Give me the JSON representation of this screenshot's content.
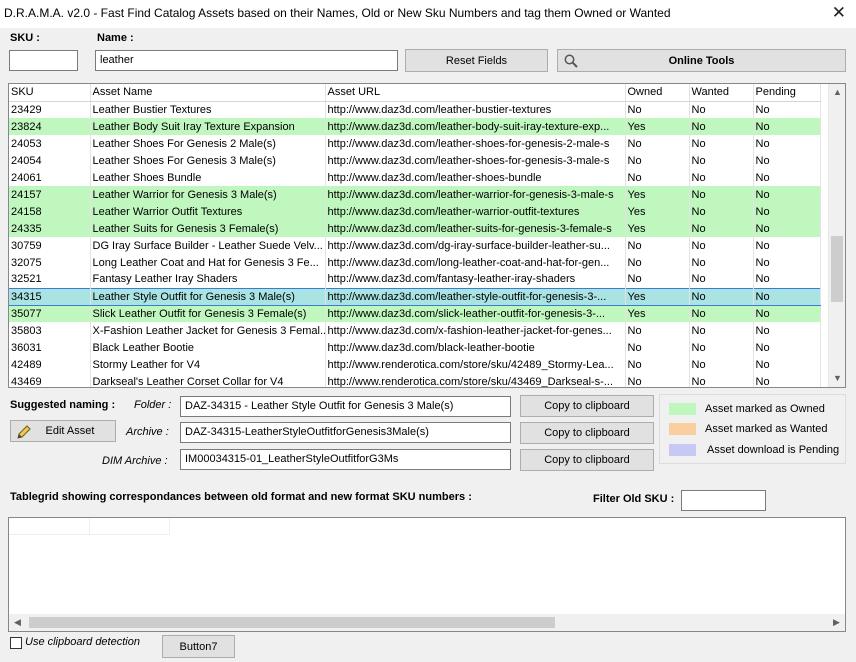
{
  "window": {
    "title": "D.R.A.M.A. v2.0 - Fast Find Catalog Assets based on their Names, Old or New Sku Numbers and tag them Owned or Wanted",
    "close_icon": "close-icon"
  },
  "search": {
    "sku_label": "SKU :",
    "sku_value": "",
    "name_label": "Name :",
    "name_value": "leather",
    "reset_label": "Reset Fields",
    "online_tools_label": "Online Tools",
    "online_tools_icon": "search-icon"
  },
  "assets": {
    "columns": [
      "SKU",
      "Asset Name",
      "Asset URL",
      "Owned",
      "Wanted",
      "Pending"
    ],
    "rows": [
      {
        "sku": "23429",
        "name": "Leather Bustier Textures",
        "url": "http://www.daz3d.com/leather-bustier-textures",
        "owned": "No",
        "wanted": "No",
        "pending": "No",
        "state": "normal"
      },
      {
        "sku": "23824",
        "name": "Leather Body Suit Iray Texture Expansion",
        "url": "http://www.daz3d.com/leather-body-suit-iray-texture-exp...",
        "owned": "Yes",
        "wanted": "No",
        "pending": "No",
        "state": "owned"
      },
      {
        "sku": "24053",
        "name": "Leather Shoes For Genesis 2 Male(s)",
        "url": "http://www.daz3d.com/leather-shoes-for-genesis-2-male-s",
        "owned": "No",
        "wanted": "No",
        "pending": "No",
        "state": "normal"
      },
      {
        "sku": "24054",
        "name": "Leather Shoes For Genesis 3 Male(s)",
        "url": "http://www.daz3d.com/leather-shoes-for-genesis-3-male-s",
        "owned": "No",
        "wanted": "No",
        "pending": "No",
        "state": "normal"
      },
      {
        "sku": "24061",
        "name": "Leather Shoes Bundle",
        "url": "http://www.daz3d.com/leather-shoes-bundle",
        "owned": "No",
        "wanted": "No",
        "pending": "No",
        "state": "normal"
      },
      {
        "sku": "24157",
        "name": "Leather Warrior for Genesis 3 Male(s)",
        "url": "http://www.daz3d.com/leather-warrior-for-genesis-3-male-s",
        "owned": "Yes",
        "wanted": "No",
        "pending": "No",
        "state": "owned"
      },
      {
        "sku": "24158",
        "name": "Leather Warrior Outfit Textures",
        "url": "http://www.daz3d.com/leather-warrior-outfit-textures",
        "owned": "Yes",
        "wanted": "No",
        "pending": "No",
        "state": "owned"
      },
      {
        "sku": "24335",
        "name": "Leather Suits for Genesis 3 Female(s)",
        "url": "http://www.daz3d.com/leather-suits-for-genesis-3-female-s",
        "owned": "Yes",
        "wanted": "No",
        "pending": "No",
        "state": "owned"
      },
      {
        "sku": "30759",
        "name": "DG Iray Surface Builder - Leather Suede Velv...",
        "url": "http://www.daz3d.com/dg-iray-surface-builder-leather-su...",
        "owned": "No",
        "wanted": "No",
        "pending": "No",
        "state": "normal"
      },
      {
        "sku": "32075",
        "name": "Long Leather Coat and Hat for Genesis 3 Fe...",
        "url": "http://www.daz3d.com/long-leather-coat-and-hat-for-gen...",
        "owned": "No",
        "wanted": "No",
        "pending": "No",
        "state": "normal"
      },
      {
        "sku": "32521",
        "name": "Fantasy Leather Iray Shaders",
        "url": "http://www.daz3d.com/fantasy-leather-iray-shaders",
        "owned": "No",
        "wanted": "No",
        "pending": "No",
        "state": "normal"
      },
      {
        "sku": "34315",
        "name": "Leather Style Outfit for Genesis 3 Male(s)",
        "url": "http://www.daz3d.com/leather-style-outfit-for-genesis-3-...",
        "owned": "Yes",
        "wanted": "No",
        "pending": "No",
        "state": "selected"
      },
      {
        "sku": "35077",
        "name": "Slick Leather Outfit for Genesis 3 Female(s)",
        "url": "http://www.daz3d.com/slick-leather-outfit-for-genesis-3-...",
        "owned": "Yes",
        "wanted": "No",
        "pending": "No",
        "state": "owned"
      },
      {
        "sku": "35803",
        "name": "X-Fashion Leather Jacket for Genesis 3 Femal...",
        "url": "http://www.daz3d.com/x-fashion-leather-jacket-for-genes...",
        "owned": "No",
        "wanted": "No",
        "pending": "No",
        "state": "normal"
      },
      {
        "sku": "36031",
        "name": "Black Leather Bootie",
        "url": "http://www.daz3d.com/black-leather-bootie",
        "owned": "No",
        "wanted": "No",
        "pending": "No",
        "state": "normal"
      },
      {
        "sku": "42489",
        "name": "Stormy Leather for V4",
        "url": "http://www.renderotica.com/store/sku/42489_Stormy-Lea...",
        "owned": "No",
        "wanted": "No",
        "pending": "No",
        "state": "normal"
      },
      {
        "sku": "43469",
        "name": "Darkseal's Leather Corset Collar for V4",
        "url": "http://www.renderotica.com/store/sku/43469_Darkseal-s-...",
        "owned": "No",
        "wanted": "No",
        "pending": "No",
        "state": "normal"
      }
    ]
  },
  "naming": {
    "section_label": "Suggested naming :",
    "folder_label": "Folder :",
    "folder_value": "DAZ-34315 - Leather Style Outfit for Genesis 3 Male(s)",
    "archive_label": "Archive :",
    "archive_value": "DAZ-34315-LeatherStyleOutfitforGenesis3Male(s)",
    "dim_label": "DIM Archive :",
    "dim_value": "IM00034315-01_LeatherStyleOutfitforG3Ms",
    "copy_label": "Copy to clipboard",
    "edit_asset_label": "Edit Asset",
    "edit_icon": "pencil-icon"
  },
  "legend": {
    "items": [
      {
        "label": "Asset marked as Owned",
        "color": "#bff7bf"
      },
      {
        "label": "Asset marked as Wanted",
        "color": "#f9cf9f"
      },
      {
        "label": "Asset download is Pending",
        "color": "#c8c8f4"
      }
    ]
  },
  "correspondence": {
    "title": "Tablegrid showing correspondances between old format and new format SKU numbers :",
    "filter_label": "Filter Old SKU :",
    "filter_value": ""
  },
  "footer": {
    "clipboard_label": "Use clipboard detection",
    "clipboard_checked": false,
    "button7_label": "Button7"
  }
}
